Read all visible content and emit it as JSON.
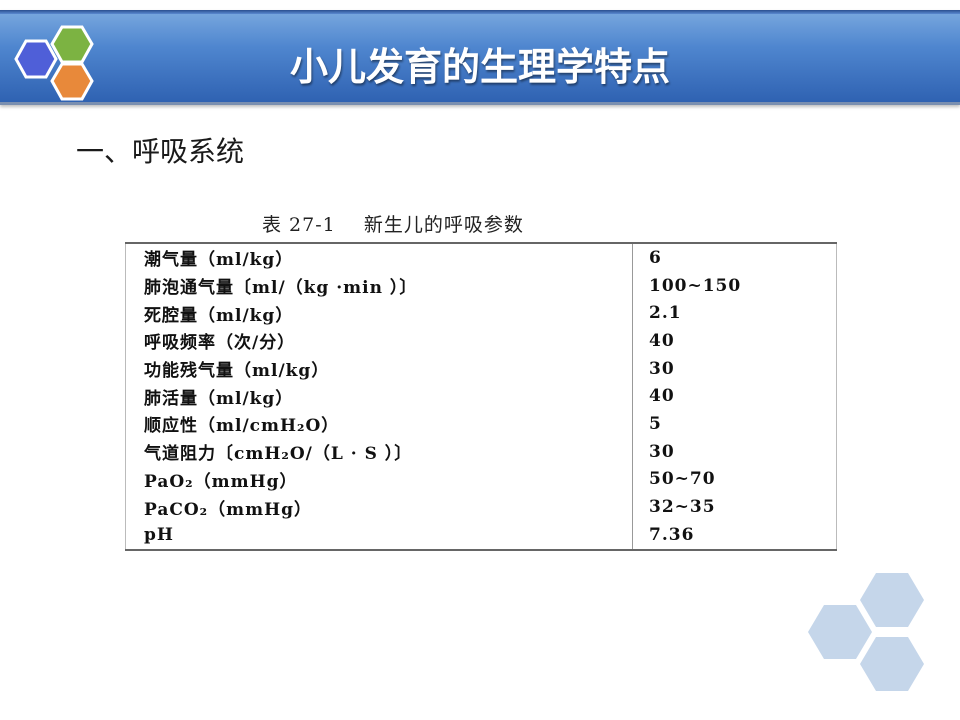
{
  "header": {
    "title": "小儿发育的生理学特点",
    "logo_colors": [
      "#4f5fd8",
      "#7cb342",
      "#e8893a"
    ]
  },
  "section": {
    "heading": "一、呼吸系统"
  },
  "table": {
    "caption": "表 27-1    新生儿的呼吸参数",
    "rows": [
      {
        "name": "潮气量（ml/kg）",
        "value": "6"
      },
      {
        "name": "肺泡通气量〔ml/（kg  ·min ）〕",
        "value": "100~150"
      },
      {
        "name": "死腔量（ml/kg）",
        "value": "2.1"
      },
      {
        "name": "呼吸频率（次/分）",
        "value": "40"
      },
      {
        "name": "功能残气量（ml/kg）",
        "value": "30"
      },
      {
        "name": "肺活量（ml/kg）",
        "value": "40"
      },
      {
        "name": "顺应性（ml/cmH₂O）",
        "value": "5"
      },
      {
        "name": "气道阻力〔cmH₂O/（L · S ）〕",
        "value": "30"
      },
      {
        "name": "PaO₂（mmHg）",
        "value": "50~70"
      },
      {
        "name": "PaCO₂（mmHg）",
        "value": "32~35"
      },
      {
        "name": "pH",
        "value": "7.36"
      }
    ]
  },
  "decoration": {
    "hex_color": "#c5d6ea"
  }
}
